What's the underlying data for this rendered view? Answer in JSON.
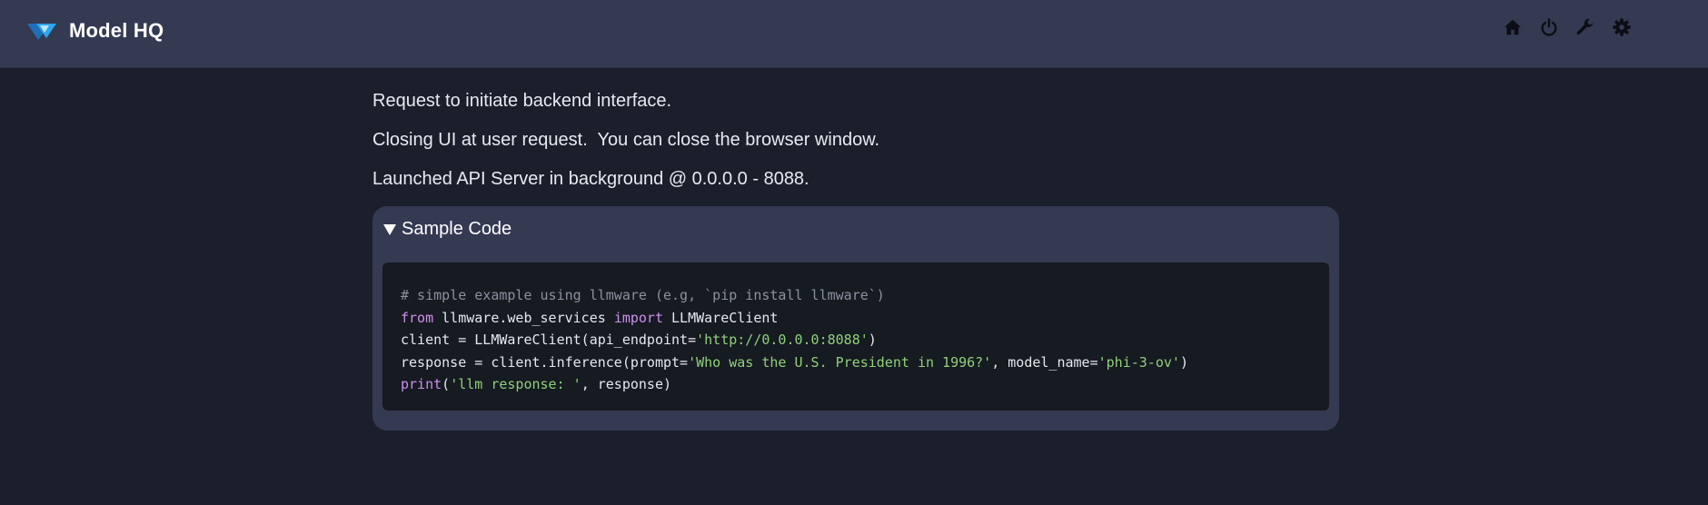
{
  "app": {
    "title": "Model HQ"
  },
  "header": {
    "icons": [
      "home-icon",
      "power-icon",
      "wrench-icon",
      "gear-icon"
    ]
  },
  "messages": [
    "Request to initiate backend interface.",
    "Closing UI at user request.  You can close the browser window.",
    "Launched API Server in background @ 0.0.0.0 - 8088."
  ],
  "sample_code": {
    "summary": "Sample Code",
    "comment": "# simple example using llmware (e.g, `pip install llmware`)",
    "kw_from": "from",
    "module": " llmware.web_services ",
    "kw_import": "import",
    "import_name": " LLMWareClient",
    "l3_pre": "client = LLMWareClient(api_endpoint=",
    "l3_str": "'http://0.0.0.0:8088'",
    "l3_post": ")",
    "l4_pre": "response = client.inference(prompt=",
    "l4_str1": "'Who was the U.S. President in 1996?'",
    "l4_mid": ", model_name=",
    "l4_str2": "'phi-3-ov'",
    "l4_post": ")",
    "kw_print": "print",
    "l5_open": "(",
    "l5_str": "'llm response: '",
    "l5_post": ", response)"
  },
  "colors": {
    "header_bg": "#343a52",
    "page_bg": "#1b1f2c",
    "code_bg": "#161a21",
    "keyword": "#cf8ef0",
    "string": "#8fd17a",
    "comment": "#8b919e",
    "logo_accent": "#1e9be8"
  }
}
